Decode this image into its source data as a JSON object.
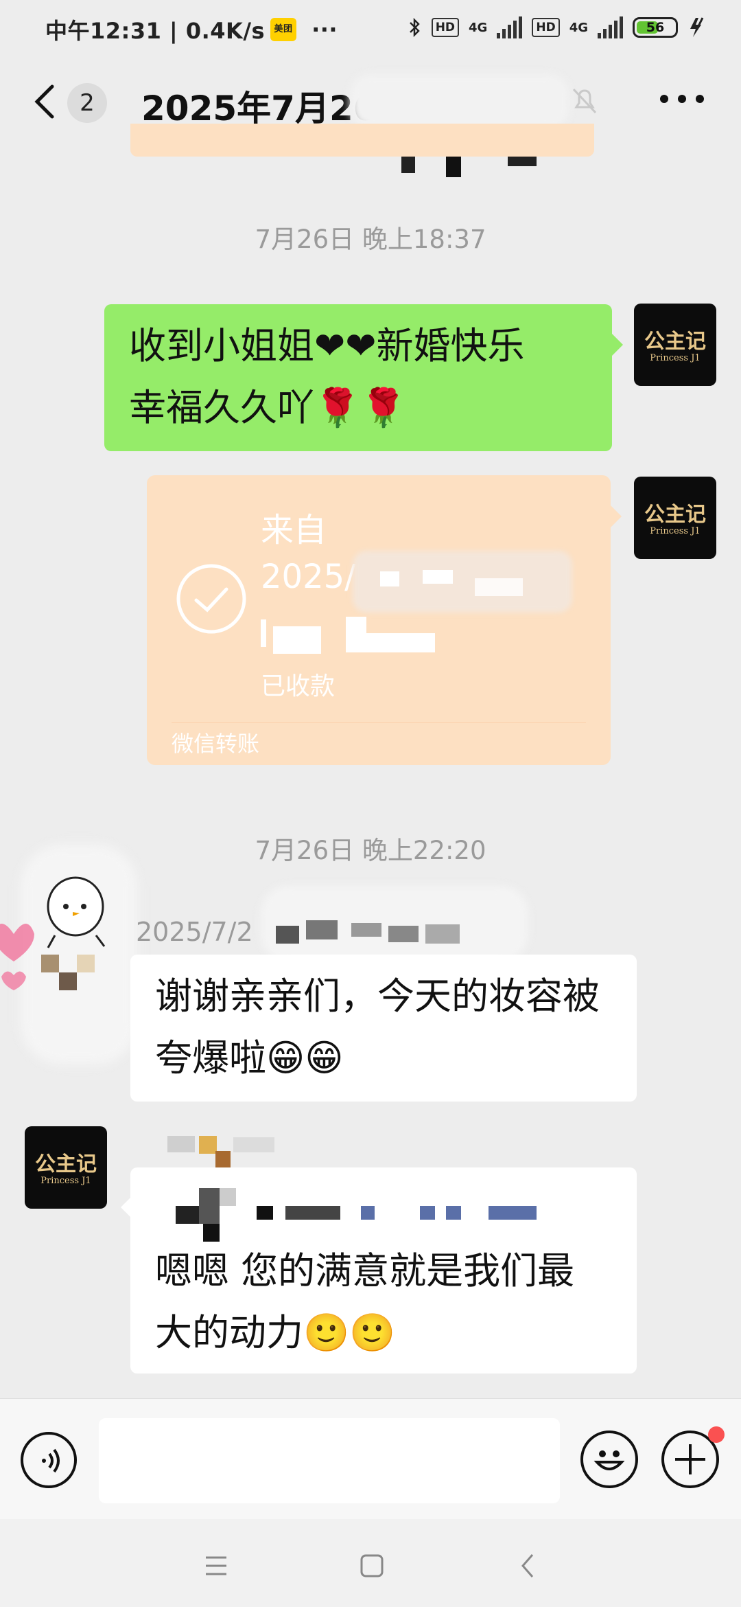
{
  "status_bar": {
    "time_speed": "中午12:31 | 0.4K/s",
    "app_badge": "美团",
    "more": "···",
    "hd1": "HD",
    "net1": "4G",
    "hd2": "HD",
    "net2": "4G",
    "battery": "56"
  },
  "header": {
    "unread_count": "2",
    "title": "2025年7月26"
  },
  "messages": {
    "time1": "7月26日 晚上18:37",
    "msg1_line1": "收到小姐姐❤❤新婚快乐",
    "msg1_line2": "幸福久久吖🌹🌹",
    "transfer": {
      "from_label": "来自",
      "title": "2025/",
      "status": "已收款",
      "footer": "微信转账"
    },
    "time2": "7月26日 晚上22:20",
    "sender_name": "2025/7/2",
    "msg2_line1": "谢谢亲亲们，今天的妆容被",
    "msg2_line2": "夸爆啦😁😁",
    "msg3_line1": "嗯嗯 您的满意就是我们最",
    "msg3_line2": "大的动力🙂🙂"
  },
  "avatar": {
    "logo_cn": "公主记",
    "logo_en": "Princess J1"
  },
  "colors": {
    "bubble_green": "#95ec69",
    "transfer_orange": "#fde0c2",
    "background": "#ededed"
  }
}
